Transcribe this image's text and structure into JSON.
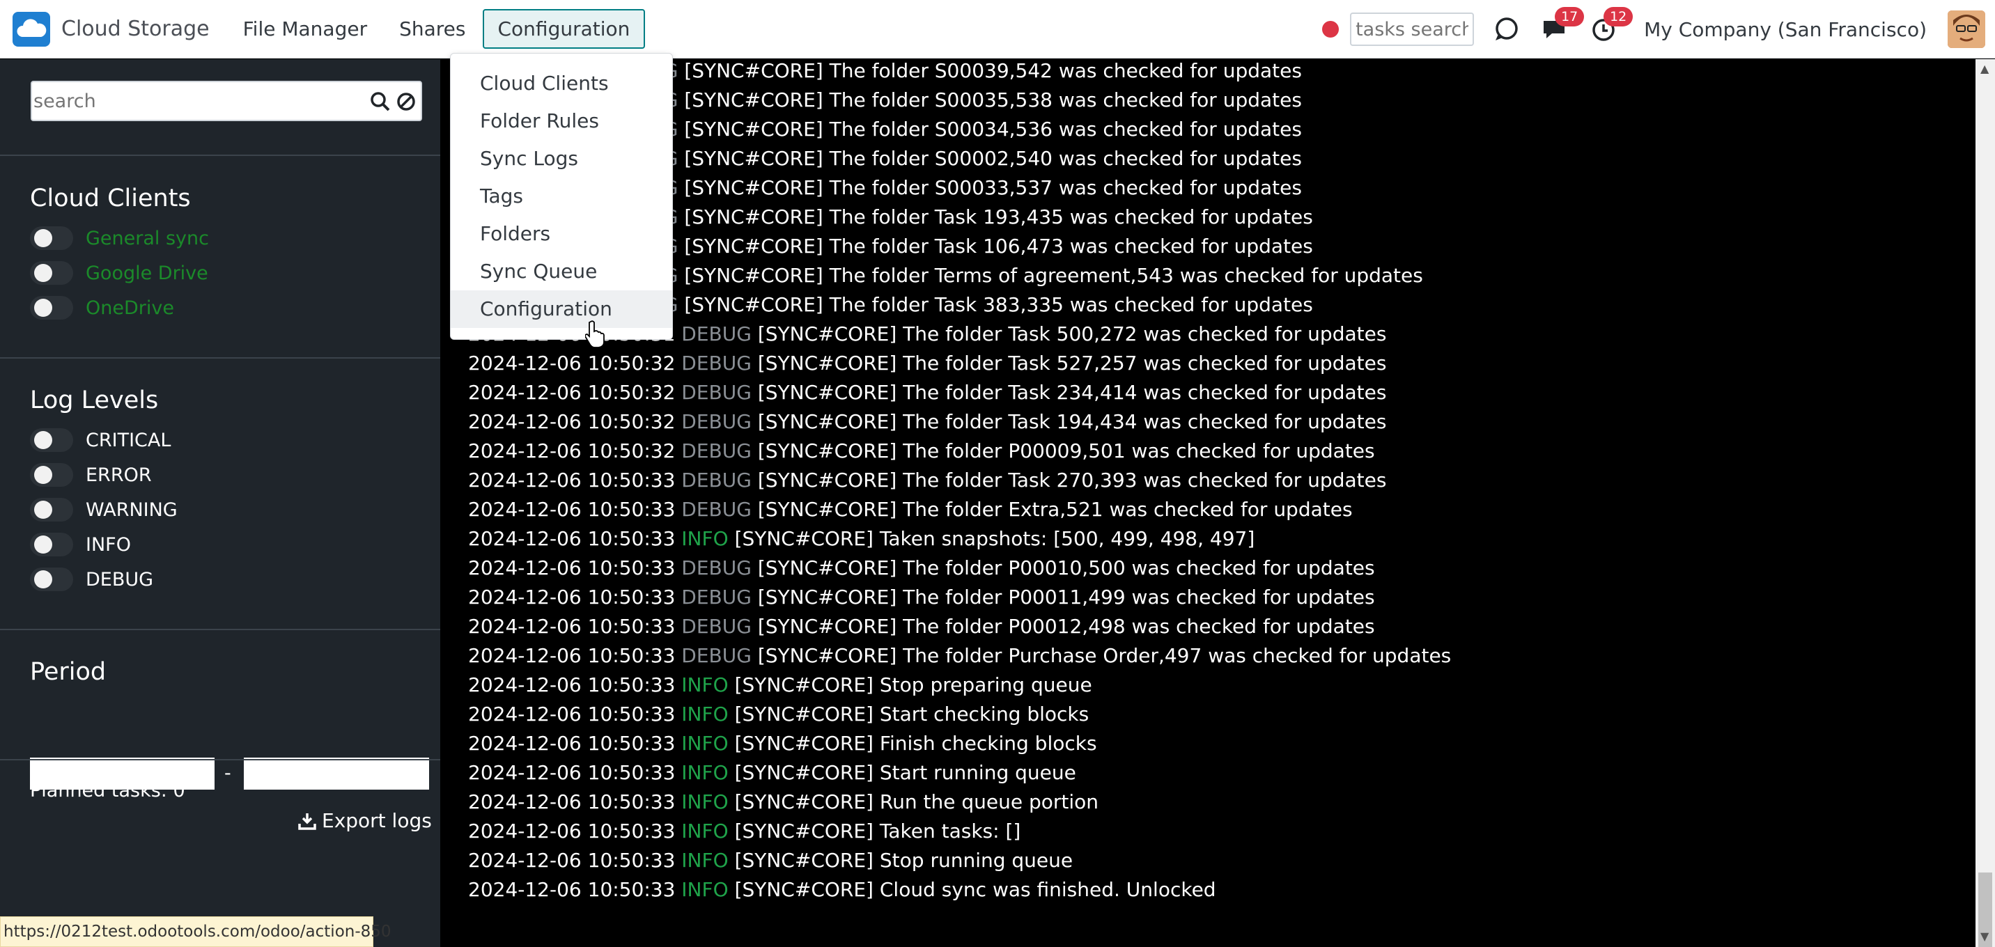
{
  "app": {
    "name": "Cloud Storage",
    "logo_icon": "cloud-icon"
  },
  "menu": [
    {
      "label": "File Manager"
    },
    {
      "label": "Shares"
    },
    {
      "label": "Configuration",
      "active": true
    }
  ],
  "navbar": {
    "tasks_search_placeholder": "tasks search",
    "messages_badge": "17",
    "activities_badge": "12",
    "company": "My Company (San Francisco)"
  },
  "dropdown": [
    {
      "label": "Cloud Clients"
    },
    {
      "label": "Folder Rules"
    },
    {
      "label": "Sync Logs"
    },
    {
      "label": "Tags"
    },
    {
      "label": "Folders"
    },
    {
      "label": "Sync Queue"
    },
    {
      "label": "Configuration",
      "hovered": true
    }
  ],
  "sidebar": {
    "search_placeholder": "search",
    "cloud_clients_title": "Cloud Clients",
    "cloud_clients": [
      "General sync",
      "Google Drive",
      "OneDrive"
    ],
    "log_levels_title": "Log Levels",
    "log_levels": [
      "CRITICAL",
      "ERROR",
      "WARNING",
      "INFO",
      "DEBUG"
    ],
    "period_title": "Period",
    "period_separator": "-",
    "planned_tasks": "Planned tasks: 0",
    "export_label": "Export logs"
  },
  "status_url": "https://0212test.odootools.com/odoo/action-850",
  "colors": {
    "accent": "#017e84",
    "info": "#1fa34a",
    "debug": "#8a8f95",
    "badge": "#dc3545",
    "link_green": "#1b8a2a"
  },
  "logs": [
    {
      "ts": "",
      "level": "BUG",
      "message": "[SYNC#CORE] The folder S00039,542 was checked for updates"
    },
    {
      "ts": "",
      "level": "BUG",
      "message": "[SYNC#CORE] The folder S00035,538 was checked for updates"
    },
    {
      "ts": "",
      "level": "BUG",
      "message": "[SYNC#CORE] The folder S00034,536 was checked for updates"
    },
    {
      "ts": "",
      "level": "BUG",
      "message": "[SYNC#CORE] The folder S00002,540 was checked for updates"
    },
    {
      "ts": "",
      "level": "BUG",
      "message": "[SYNC#CORE] The folder S00033,537 was checked for updates"
    },
    {
      "ts": "",
      "level": "BUG",
      "message": "[SYNC#CORE] The folder Task 193,435 was checked for updates"
    },
    {
      "ts": "",
      "level": "BUG",
      "message": "[SYNC#CORE] The folder Task 106,473 was checked for updates"
    },
    {
      "ts": "",
      "level": "BUG",
      "message": "[SYNC#CORE] The folder Terms of agreement,543 was checked for updates"
    },
    {
      "ts": "",
      "level": "BUG",
      "message": "[SYNC#CORE] The folder Task 383,335 was checked for updates"
    },
    {
      "ts": "2024-12-06 10:50:31",
      "level": "DEBUG",
      "message": "[SYNC#CORE] The folder Task 500,272 was checked for updates"
    },
    {
      "ts": "2024-12-06 10:50:32",
      "level": "DEBUG",
      "message": "[SYNC#CORE] The folder Task 527,257 was checked for updates"
    },
    {
      "ts": "2024-12-06 10:50:32",
      "level": "DEBUG",
      "message": "[SYNC#CORE] The folder Task 234,414 was checked for updates"
    },
    {
      "ts": "2024-12-06 10:50:32",
      "level": "DEBUG",
      "message": "[SYNC#CORE] The folder Task 194,434 was checked for updates"
    },
    {
      "ts": "2024-12-06 10:50:32",
      "level": "DEBUG",
      "message": "[SYNC#CORE] The folder P00009,501 was checked for updates"
    },
    {
      "ts": "2024-12-06 10:50:33",
      "level": "DEBUG",
      "message": "[SYNC#CORE] The folder Task 270,393 was checked for updates"
    },
    {
      "ts": "2024-12-06 10:50:33",
      "level": "DEBUG",
      "message": "[SYNC#CORE] The folder Extra,521 was checked for updates"
    },
    {
      "ts": "2024-12-06 10:50:33",
      "level": "INFO",
      "message": "[SYNC#CORE] Taken snapshots: [500, 499, 498, 497]"
    },
    {
      "ts": "2024-12-06 10:50:33",
      "level": "DEBUG",
      "message": "[SYNC#CORE] The folder P00010,500 was checked for updates"
    },
    {
      "ts": "2024-12-06 10:50:33",
      "level": "DEBUG",
      "message": "[SYNC#CORE] The folder P00011,499 was checked for updates"
    },
    {
      "ts": "2024-12-06 10:50:33",
      "level": "DEBUG",
      "message": "[SYNC#CORE] The folder P00012,498 was checked for updates"
    },
    {
      "ts": "2024-12-06 10:50:33",
      "level": "DEBUG",
      "message": "[SYNC#CORE] The folder Purchase Order,497 was checked for updates"
    },
    {
      "ts": "2024-12-06 10:50:33",
      "level": "INFO",
      "message": "[SYNC#CORE] Stop preparing queue"
    },
    {
      "ts": "2024-12-06 10:50:33",
      "level": "INFO",
      "message": "[SYNC#CORE] Start checking blocks"
    },
    {
      "ts": "2024-12-06 10:50:33",
      "level": "INFO",
      "message": "[SYNC#CORE] Finish checking blocks"
    },
    {
      "ts": "2024-12-06 10:50:33",
      "level": "INFO",
      "message": "[SYNC#CORE] Start running queue"
    },
    {
      "ts": "2024-12-06 10:50:33",
      "level": "INFO",
      "message": "[SYNC#CORE] Run the queue portion"
    },
    {
      "ts": "2024-12-06 10:50:33",
      "level": "INFO",
      "message": "[SYNC#CORE] Taken tasks: []"
    },
    {
      "ts": "2024-12-06 10:50:33",
      "level": "INFO",
      "message": "[SYNC#CORE] Stop running queue"
    },
    {
      "ts": "2024-12-06 10:50:33",
      "level": "INFO",
      "message": "[SYNC#CORE] Cloud sync was finished. Unlocked"
    }
  ]
}
